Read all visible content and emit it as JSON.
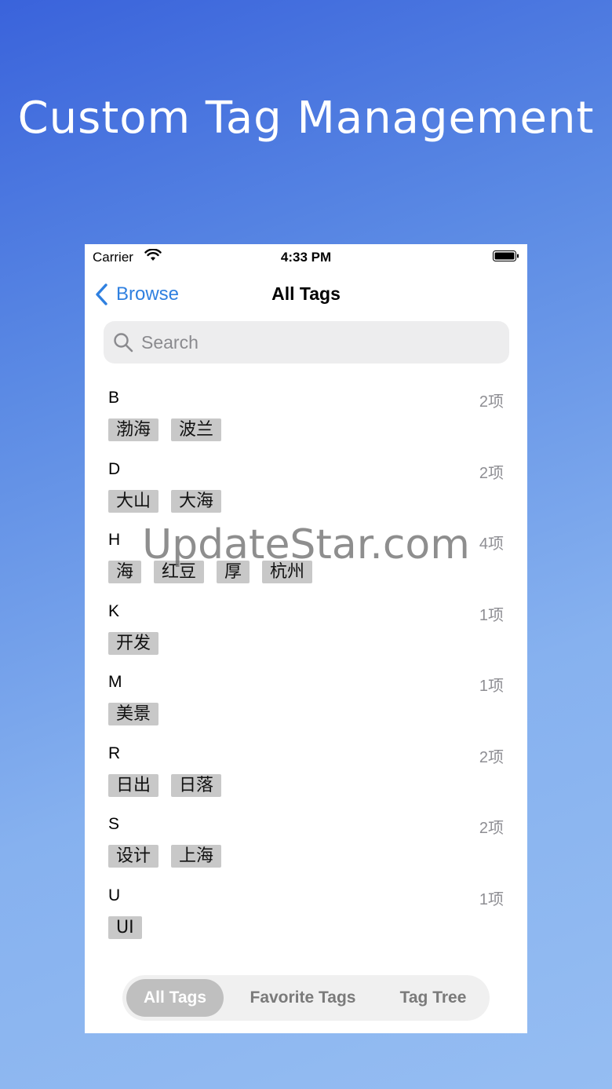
{
  "headline": "Custom Tag Management",
  "status_bar": {
    "carrier": "Carrier",
    "time": "4:33 PM"
  },
  "navbar": {
    "back_label": "Browse",
    "title": "All Tags"
  },
  "search": {
    "placeholder": "Search"
  },
  "sections": [
    {
      "letter": "B",
      "count": "2项",
      "tags": [
        "渤海",
        "波兰"
      ]
    },
    {
      "letter": "D",
      "count": "2项",
      "tags": [
        "大山",
        "大海"
      ]
    },
    {
      "letter": "H",
      "count": "4项",
      "tags": [
        "海",
        "红豆",
        "厚",
        "杭州"
      ]
    },
    {
      "letter": "K",
      "count": "1项",
      "tags": [
        "开发"
      ]
    },
    {
      "letter": "M",
      "count": "1项",
      "tags": [
        "美景"
      ]
    },
    {
      "letter": "R",
      "count": "2项",
      "tags": [
        "日出",
        "日落"
      ]
    },
    {
      "letter": "S",
      "count": "2项",
      "tags": [
        "设计",
        "上海"
      ]
    },
    {
      "letter": "U",
      "count": "1项",
      "tags": [
        "UI"
      ]
    }
  ],
  "segments": [
    "All Tags",
    "Favorite Tags",
    "Tag Tree"
  ],
  "active_segment": "All Tags",
  "watermark": "UpdateStar.com",
  "colors": {
    "accent": "#2f80e0",
    "tag_bg": "#c8c8c8",
    "background_top": "#3a63db",
    "background_bottom": "#95bdf2"
  }
}
